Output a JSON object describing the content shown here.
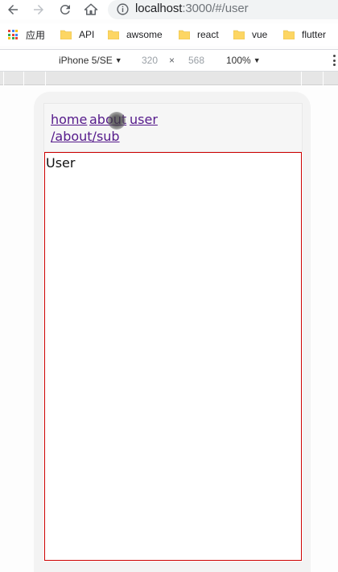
{
  "browser": {
    "url_host": "localhost",
    "url_rest": ":3000/#/user"
  },
  "bookmarks": {
    "apps_label": "应用",
    "items": [
      {
        "label": "API"
      },
      {
        "label": "awsome"
      },
      {
        "label": "react"
      },
      {
        "label": "vue"
      },
      {
        "label": "flutter"
      }
    ],
    "folder_color": "#fdd663"
  },
  "device_toolbar": {
    "device": "iPhone 5/SE",
    "width": "320",
    "times": "×",
    "height": "568",
    "zoom": "100%"
  },
  "app": {
    "nav": {
      "home": "home",
      "about": "about",
      "user": "user",
      "about_sub": "/about/sub"
    },
    "view_text": "User",
    "link_color": "#551a8b",
    "view_border_color": "#cc0000"
  }
}
